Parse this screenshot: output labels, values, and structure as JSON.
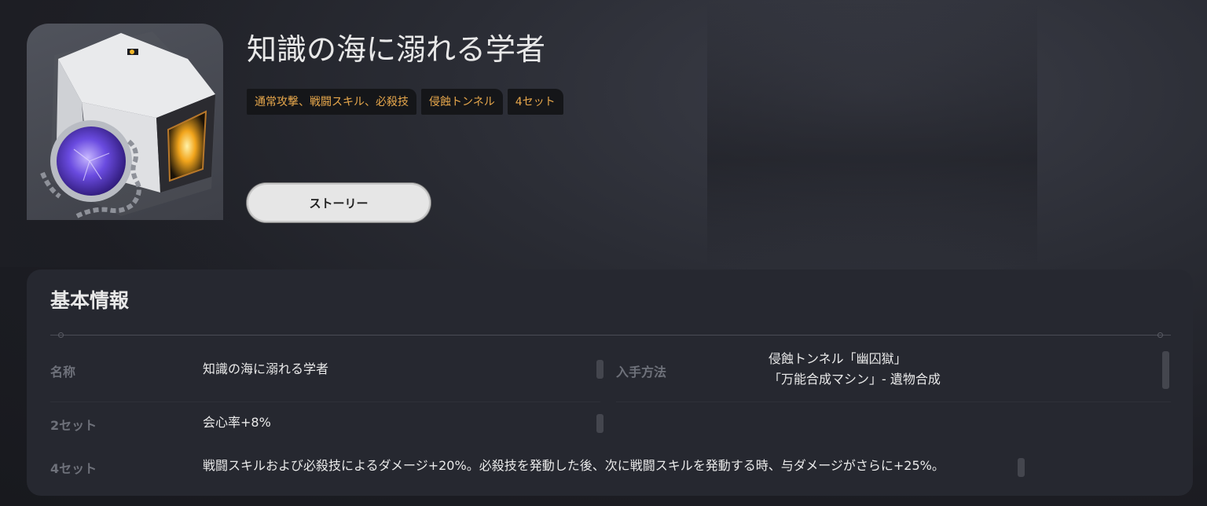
{
  "item": {
    "title": "知識の海に溺れる学者",
    "tags": [
      "通常攻撃、戦闘スキル、必殺技",
      "侵蝕トンネル",
      "4セット"
    ],
    "story_button": "ストーリー"
  },
  "info": {
    "section_title": "基本情報",
    "name_label": "名称",
    "name_value": "知識の海に溺れる学者",
    "source_label": "入手方法",
    "source_values": [
      "侵蝕トンネル「幽囚獄」",
      "「万能合成マシン」- 遺物合成"
    ],
    "set2_label": "2セット",
    "set2_value": "会心率+8%",
    "set4_label": "4セット",
    "set4_value": "戦闘スキルおよび必殺技によるダメージ+20%。必殺技を発動した後、次に戦闘スキルを発動する時、与ダメージがさらに+25%。"
  },
  "colors": {
    "tag_text": "#e8a84c",
    "panel_bg": "#262830",
    "label_text": "#6e717a"
  }
}
